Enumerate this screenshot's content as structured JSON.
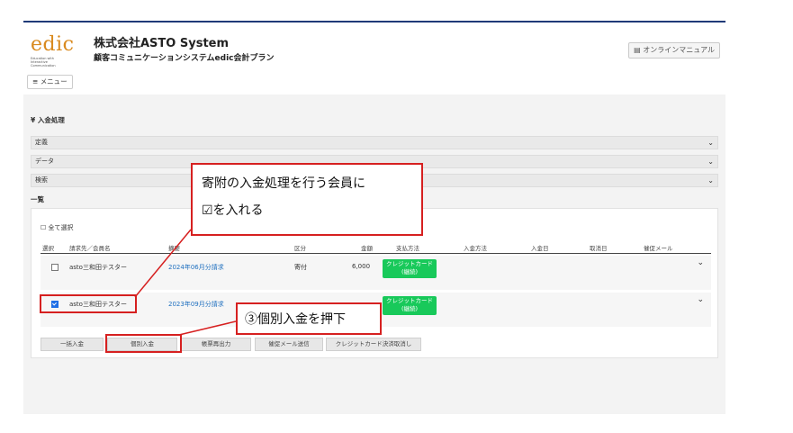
{
  "header": {
    "logo_text": "edic",
    "logo_sub": [
      "Education with",
      "Interactive",
      "Communication"
    ],
    "company": "株式会社ASTO System",
    "plan": "顧客コミュニケーションシステムedic会計プラン",
    "manual_label": "オンラインマニュアル",
    "menu_label": "メニュー"
  },
  "section_title": "¥ 入金処理",
  "accordions": [
    {
      "label": "定義"
    },
    {
      "label": "データ"
    },
    {
      "label": "検索"
    }
  ],
  "list_title": "一覧",
  "select_all": "全て選択",
  "columns": [
    "選択",
    "請求先／会員名",
    "摘要",
    "区分",
    "金額",
    "支払方法",
    "入金方法",
    "入金日",
    "取消日",
    "催促メール"
  ],
  "rows": [
    {
      "checked": false,
      "name": "asto三和田テスター",
      "summary": "2024年06月分請求",
      "category": "寄付",
      "amount": "6,000",
      "pay_line1": "クレジットカード",
      "pay_line2": "(継続)"
    },
    {
      "checked": true,
      "name": "asto三和田テスター",
      "summary": "2023年09月分請求",
      "category": "",
      "amount": "",
      "pay_line1": "クレジットカード",
      "pay_line2": "(継続)"
    }
  ],
  "buttons": [
    "一括入金",
    "個別入金",
    "帳票再出力",
    "催促メール送信",
    "クレジットカード決済取消し"
  ],
  "callouts": {
    "top_line1": "寄附の入金処理を行う会員に",
    "top_line2": "☑を入れる",
    "bottom": "③個別入金を押下"
  },
  "colors": {
    "accent": "#1f3a78",
    "annotation": "#d62020",
    "badge": "#18c95a",
    "link": "#1e6fbf"
  }
}
